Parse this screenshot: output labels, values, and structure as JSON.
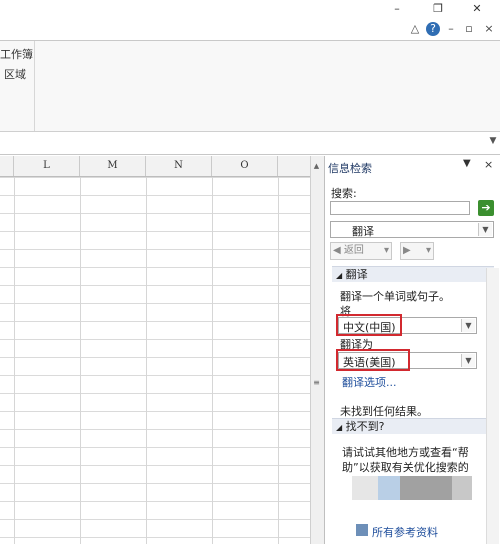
{
  "window": {
    "minimize": "–",
    "restore": "❐",
    "close": "✕"
  },
  "ribbon": {
    "group_line1": "工作簿",
    "group_line2": "区域"
  },
  "columns": [
    "L",
    "M",
    "N",
    "O"
  ],
  "research_pane": {
    "title": "信息检索",
    "search_label": "搜索:",
    "search_value": "",
    "service_value": "翻译",
    "back_label": "返回",
    "section_translate": "翻译",
    "instruction": "翻译一个单词或句子。",
    "from_label": "将",
    "from_value": "中文(中国)",
    "to_label": "翻译为",
    "to_value": "英语(美国)",
    "options_link": "翻译选项...",
    "no_results": "未找到任何结果。",
    "section_not_found": "找不到?",
    "help_line1": "请试试其他地方或查看“帮",
    "help_line2": "助”以获取有关优化搜索的",
    "all_references": "所有参考资料"
  },
  "colors": {
    "highlight": "#d2292f",
    "go_button": "#3b8f2f",
    "link": "#1f4e9c"
  }
}
